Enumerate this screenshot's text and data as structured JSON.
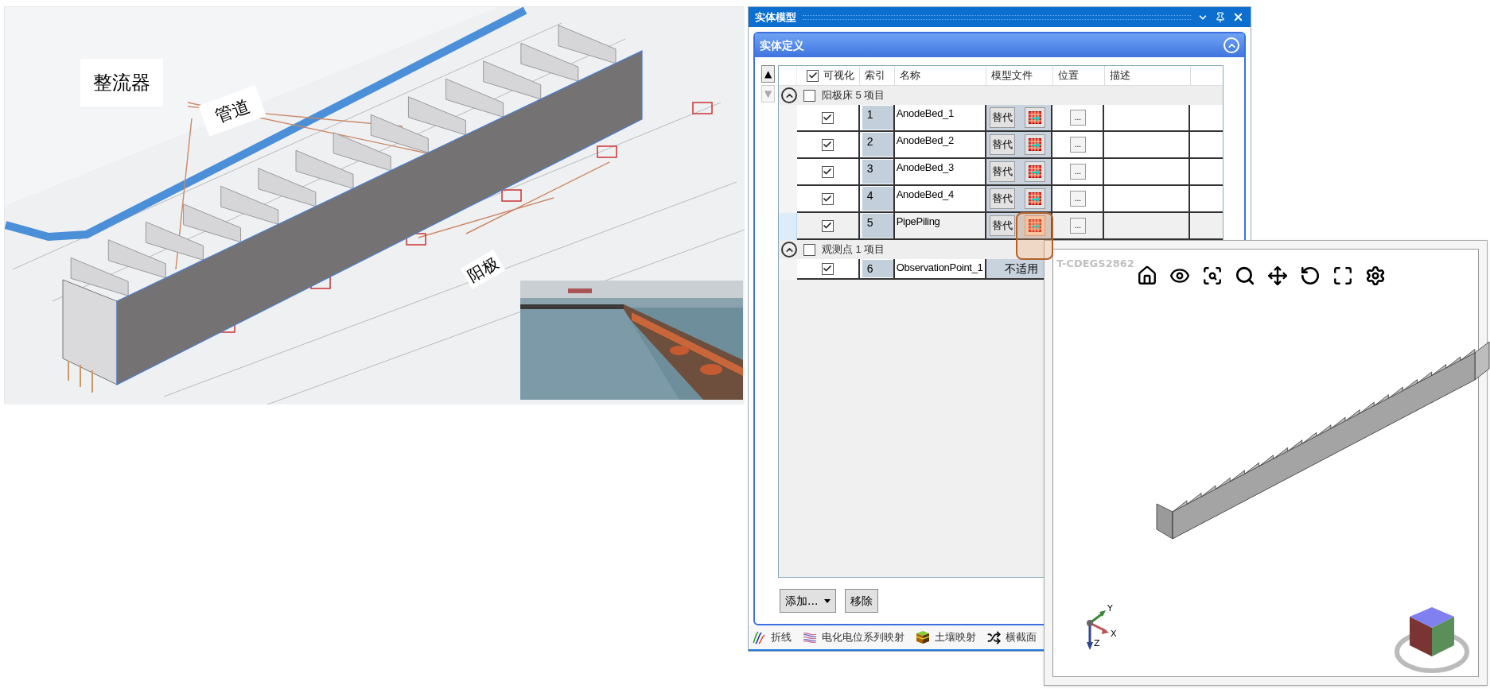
{
  "figure": {
    "callouts": [
      "整流器",
      "管道",
      "阳极"
    ],
    "photo": {
      "kind": "picture"
    }
  },
  "panel": {
    "title": "实体模型",
    "section": {
      "title": "实体定义",
      "expanded": true
    },
    "scroll_buttons": [
      {
        "symbol": "▲",
        "disabled": false
      },
      {
        "symbol": "▼",
        "disabled": true
      }
    ],
    "table": {
      "all_visible": true,
      "columns": [
        "可视化",
        "索引",
        "名称",
        "模型文件",
        "位置",
        "描述"
      ]
    },
    "groups": [
      {
        "label": "阳极床 5 项目",
        "expanded": true,
        "checked": false,
        "rows": [
          {
            "visible": true,
            "index": "1",
            "name": "AnodeBed_1",
            "selected": false,
            "model_file": {
              "kind": "buttons",
              "button": "替代",
              "highlighted": false
            },
            "position_button": "..."
          },
          {
            "visible": true,
            "index": "2",
            "name": "AnodeBed_2",
            "selected": false,
            "model_file": {
              "kind": "buttons",
              "button": "替代",
              "highlighted": false
            },
            "position_button": "..."
          },
          {
            "visible": true,
            "index": "3",
            "name": "AnodeBed_3",
            "selected": false,
            "model_file": {
              "kind": "buttons",
              "button": "替代",
              "highlighted": false
            },
            "position_button": "..."
          },
          {
            "visible": true,
            "index": "4",
            "name": "AnodeBed_4",
            "selected": false,
            "model_file": {
              "kind": "buttons",
              "button": "替代",
              "highlighted": false
            },
            "position_button": "..."
          },
          {
            "visible": true,
            "index": "5",
            "name": "PipePiling",
            "selected": true,
            "model_file": {
              "kind": "buttons",
              "button": "替代",
              "highlighted": true
            },
            "position_button": "..."
          }
        ]
      },
      {
        "label": "观测点 1 项目",
        "expanded": true,
        "checked": false,
        "rows": [
          {
            "visible": true,
            "index": "6",
            "name": "ObservationPoint_1",
            "selected": false,
            "model_file": {
              "kind": "text",
              "text": "不适用"
            }
          }
        ]
      }
    ],
    "buttons": [
      {
        "label": "添加...",
        "kind": "dropdown"
      },
      {
        "label": "移除",
        "kind": "plain"
      }
    ],
    "bottom_tabs": [
      {
        "label": "折线",
        "kind": "polyline"
      },
      {
        "label": "电化电位系列映射",
        "kind": "series"
      },
      {
        "label": "土壤映射",
        "kind": "soil"
      },
      {
        "label": "横截面",
        "kind": "section"
      }
    ]
  },
  "viewer": {
    "title": "T-CDEGS2862",
    "axes": [
      "Y",
      "X",
      "Z"
    ]
  }
}
